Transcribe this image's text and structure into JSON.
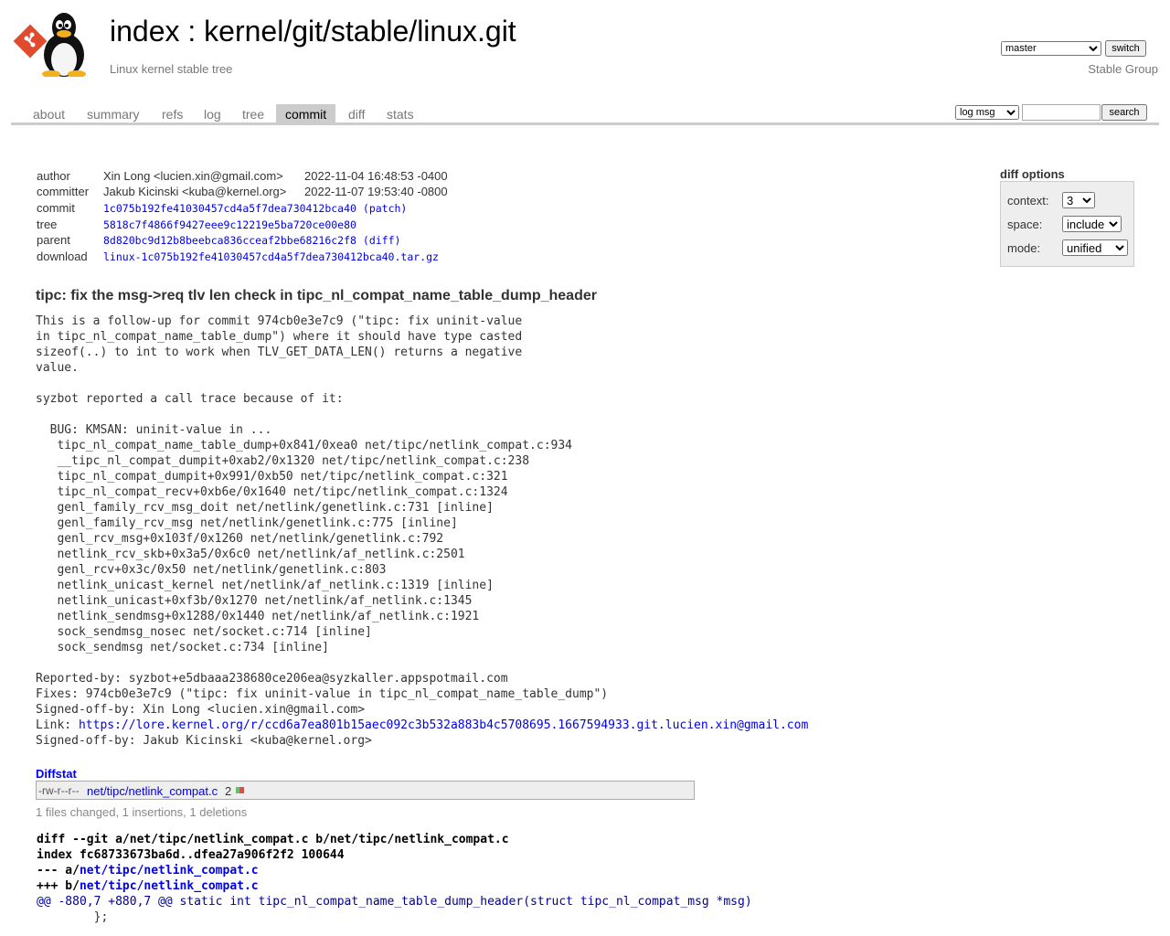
{
  "header": {
    "title_index": "index",
    "title_sep": " : ",
    "title_repo": "kernel/git/stable/linux.git",
    "subtitle": "Linux kernel stable tree",
    "owner": "Stable Group",
    "branch": "master",
    "switch_label": "switch"
  },
  "tabs": [
    "about",
    "summary",
    "refs",
    "log",
    "tree",
    "commit",
    "diff",
    "stats"
  ],
  "active_tab": "commit",
  "search": {
    "scope": "log msg",
    "button": "search",
    "value": ""
  },
  "commit": {
    "author_label": "author",
    "author": "Xin Long <lucien.xin@gmail.com>",
    "author_date": "2022-11-04 16:48:53 -0400",
    "committer_label": "committer",
    "committer": "Jakub Kicinski <kuba@kernel.org>",
    "committer_date": "2022-11-07 19:53:40 -0800",
    "commit_label": "commit",
    "commit_hash": "1c075b192fe41030457cd4a5f7dea730412bca40",
    "patch_link": "(patch)",
    "tree_label": "tree",
    "tree_hash": "5818c7f4866f9427eee9c12219e5ba720ce00e80",
    "parent_label": "parent",
    "parent_hash": "8d820bc9d12b8beebca836cceaf2bbe68216c2f8",
    "diff_link": "(diff)",
    "download_label": "download",
    "download": "linux-1c075b192fe41030457cd4a5f7dea730412bca40.tar.gz"
  },
  "diff_options": {
    "heading": "diff options",
    "context_label": "context:",
    "context_value": "3",
    "space_label": "space:",
    "space_value": "include",
    "mode_label": "mode:",
    "mode_value": "unified"
  },
  "subject": "tipc: fix the msg->req tlv len check in tipc_nl_compat_name_table_dump_header",
  "message": "This is a follow-up for commit 974cb0e3e7c9 (\"tipc: fix uninit-value\nin tipc_nl_compat_name_table_dump\") where it should have type casted\nsizeof(..) to int to work when TLV_GET_DATA_LEN() returns a negative\nvalue.\n\nsyzbot reported a call trace because of it:\n\n  BUG: KMSAN: uninit-value in ...\n   tipc_nl_compat_name_table_dump+0x841/0xea0 net/tipc/netlink_compat.c:934\n   __tipc_nl_compat_dumpit+0xab2/0x1320 net/tipc/netlink_compat.c:238\n   tipc_nl_compat_dumpit+0x991/0xb50 net/tipc/netlink_compat.c:321\n   tipc_nl_compat_recv+0xb6e/0x1640 net/tipc/netlink_compat.c:1324\n   genl_family_rcv_msg_doit net/netlink/genetlink.c:731 [inline]\n   genl_family_rcv_msg net/netlink/genetlink.c:775 [inline]\n   genl_rcv_msg+0x103f/0x1260 net/netlink/genetlink.c:792\n   netlink_rcv_skb+0x3a5/0x6c0 net/netlink/af_netlink.c:2501\n   genl_rcv+0x3c/0x50 net/netlink/genetlink.c:803\n   netlink_unicast_kernel net/netlink/af_netlink.c:1319 [inline]\n   netlink_unicast+0xf3b/0x1270 net/netlink/af_netlink.c:1345\n   netlink_sendmsg+0x1288/0x1440 net/netlink/af_netlink.c:1921\n   sock_sendmsg_nosec net/socket.c:714 [inline]\n   sock_sendmsg net/socket.c:734 [inline]\n\nReported-by: syzbot+e5dbaaa238680ce206ea@syzkaller.appspotmail.com\nFixes: 974cb0e3e7c9 (\"tipc: fix uninit-value in tipc_nl_compat_name_table_dump\")\nSigned-off-by: Xin Long <lucien.xin@gmail.com>\n",
  "link_prefix": "Link: ",
  "link_url": "https://lore.kernel.org/r/ccd6a7ea801b15aec092c3b532a883b4c5708695.1667594933.git.lucien.xin@gmail.com",
  "signoff_last": "Signed-off-by: Jakub Kicinski <kuba@kernel.org>",
  "diffstat": {
    "heading": "Diffstat",
    "mode": "-rw-r--r--",
    "file": "net/tipc/netlink_compat.c",
    "count": "2",
    "insertions": 1,
    "deletions": 1,
    "summary": "1 files changed, 1 insertions, 1 deletions"
  },
  "diff": {
    "header": "diff --git a/net/tipc/netlink_compat.c b/net/tipc/netlink_compat.c",
    "index": "index fc68733673ba6d..dfea27a906f2f2 100644",
    "minus_prefix": "--- a/",
    "minus_file": "net/tipc/netlink_compat.c",
    "plus_prefix": "+++ b/",
    "plus_file": "net/tipc/netlink_compat.c",
    "hunk": "@@ -880,7 +880,7 @@ static int tipc_nl_compat_name_table_dump_header(struct tipc_nl_compat_msg *msg)",
    "context1": "        };"
  },
  "colors": {
    "link": "#0000ee",
    "tab_active_bg": "#cccccc",
    "hunk": "#000099",
    "bar_add": "#55cc55",
    "bar_del": "#cc5555"
  }
}
